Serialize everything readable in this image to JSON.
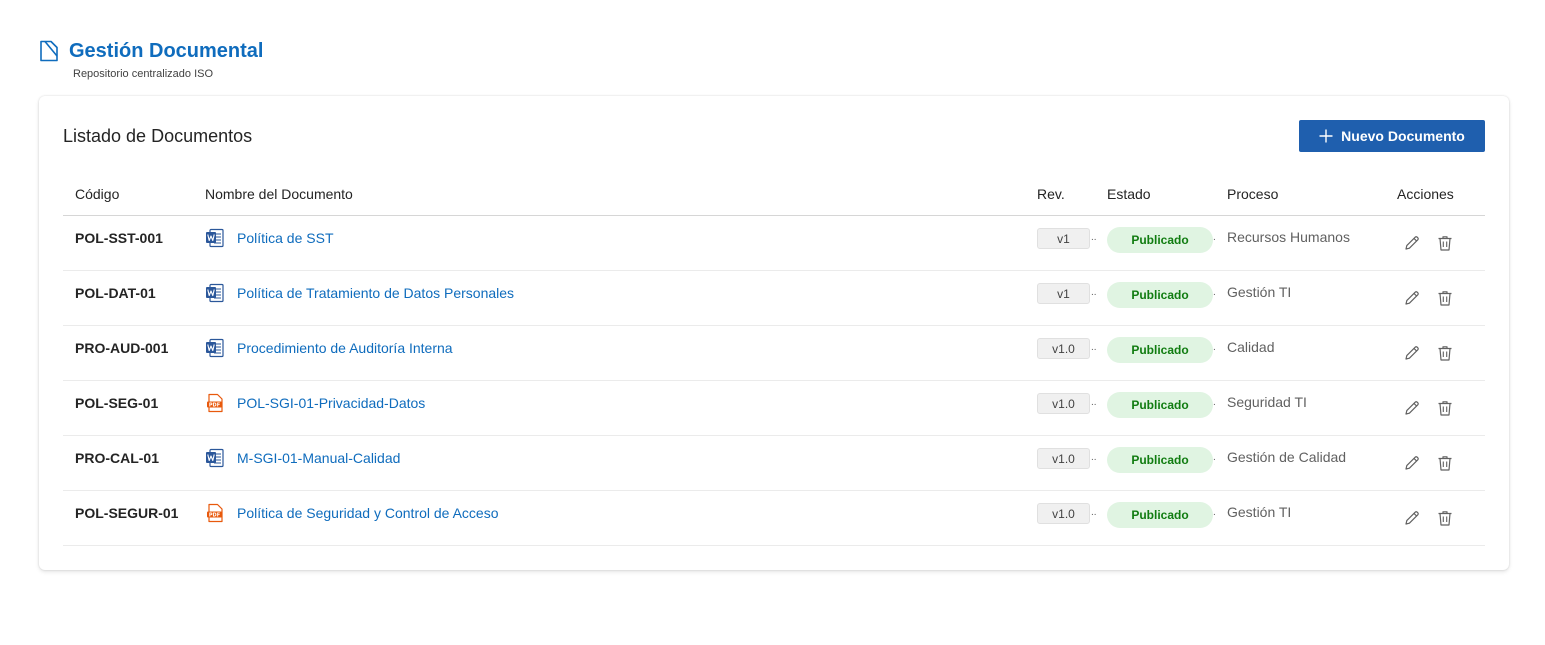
{
  "header": {
    "title": "Gestión Documental",
    "subtitle": "Repositorio centralizado ISO",
    "logo_icon": "document-icon"
  },
  "card": {
    "title": "Listado de Documentos",
    "new_button_label": "Nuevo Documento"
  },
  "table": {
    "columns": {
      "code": "Código",
      "name": "Nombre del Documento",
      "rev": "Rev.",
      "estado": "Estado",
      "proceso": "Proceso",
      "acciones": "Acciones"
    },
    "rows": [
      {
        "code": "POL-SST-001",
        "name": "Política de SST",
        "type": "word",
        "rev": "v1",
        "estado": "Publicado",
        "proceso": "Recursos Humanos"
      },
      {
        "code": "POL-DAT-01",
        "name": "Política de Tratamiento de Datos Personales",
        "type": "word",
        "rev": "v1",
        "estado": "Publicado",
        "proceso": "Gestión TI"
      },
      {
        "code": "PRO-AUD-001",
        "name": "Procedimiento de Auditoría Interna",
        "type": "word",
        "rev": "v1.0",
        "estado": "Publicado",
        "proceso": "Calidad"
      },
      {
        "code": "POL-SEG-01",
        "name": "POL-SGI-01-Privacidad-Datos",
        "type": "pdf",
        "rev": "v1.0",
        "estado": "Publicado",
        "proceso": "Seguridad TI"
      },
      {
        "code": "PRO-CAL-01",
        "name": "M-SGI-01-Manual-Calidad",
        "type": "word",
        "rev": "v1.0",
        "estado": "Publicado",
        "proceso": "Gestión de Calidad"
      },
      {
        "code": "POL-SEGUR-01",
        "name": "Política de Seguridad y Control de Acceso",
        "type": "pdf",
        "rev": "v1.0",
        "estado": "Publicado",
        "proceso": "Gestión TI"
      }
    ]
  },
  "colors": {
    "accent": "#0f6cbd",
    "button": "#1f5fae",
    "status_bg": "#e0f4e2",
    "status_text": "#107c10",
    "word_icon": "#2b579a",
    "pdf_icon": "#e8590c"
  }
}
